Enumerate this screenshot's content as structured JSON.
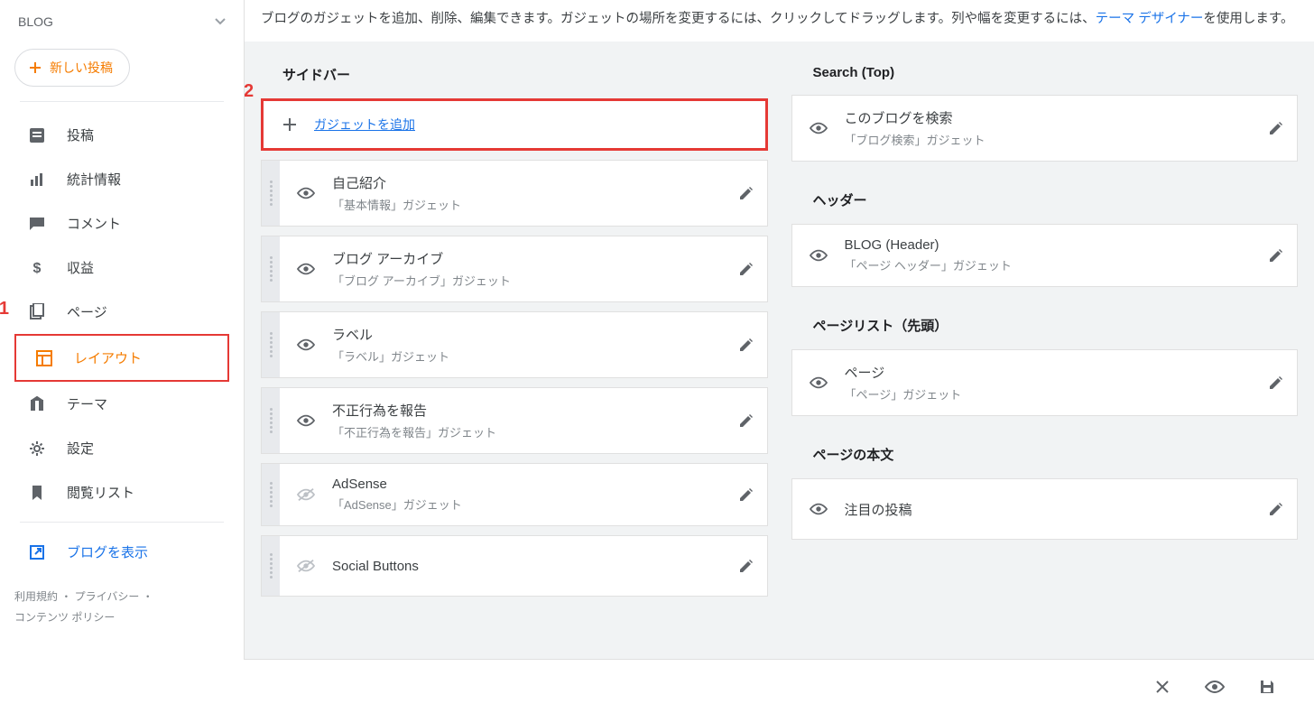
{
  "blogName": "BLOG",
  "newPostLabel": "新しい投稿",
  "nav": {
    "posts": "投稿",
    "stats": "統計情報",
    "comments": "コメント",
    "earnings": "収益",
    "pages": "ページ",
    "layout": "レイアウト",
    "theme": "テーマ",
    "settings": "設定",
    "readinglist": "閲覧リスト",
    "viewblog": "ブログを表示"
  },
  "footer": {
    "line1": "利用規約 ・ プライバシー ・",
    "line2": "コンテンツ ポリシー"
  },
  "description": {
    "pre": "ブログのガジェットを追加、削除、編集できます。ガジェットの場所を変更するには、クリックしてドラッグします。列や幅を変更するには、",
    "link": "テーマ デザイナー",
    "post": "を使用します。"
  },
  "badges": {
    "one": "1",
    "two": "2"
  },
  "left": {
    "section": "サイドバー",
    "addGadget": "ガジェットを追加",
    "gadgets": [
      {
        "title": "自己紹介",
        "sub": "「基本情報」ガジェット",
        "visible": true
      },
      {
        "title": "ブログ アーカイブ",
        "sub": "「ブログ アーカイブ」ガジェット",
        "visible": true
      },
      {
        "title": "ラベル",
        "sub": "「ラベル」ガジェット",
        "visible": true
      },
      {
        "title": "不正行為を報告",
        "sub": "「不正行為を報告」ガジェット",
        "visible": true
      },
      {
        "title": "AdSense",
        "sub": "「AdSense」ガジェット",
        "visible": false
      },
      {
        "title": "Social Buttons",
        "sub": "",
        "visible": false
      }
    ]
  },
  "right": {
    "sections": [
      {
        "title": "Search (Top)",
        "gadgets": [
          {
            "title": "このブログを検索",
            "sub": "「ブログ検索」ガジェット"
          }
        ]
      },
      {
        "title": "ヘッダー",
        "gadgets": [
          {
            "title": "BLOG (Header)",
            "sub": "「ページ ヘッダー」ガジェット"
          }
        ]
      },
      {
        "title": "ページリスト（先頭）",
        "gadgets": [
          {
            "title": "ページ",
            "sub": "「ページ」ガジェット"
          }
        ]
      },
      {
        "title": "ページの本文",
        "gadgets": [
          {
            "title": "注目の投稿",
            "sub": ""
          }
        ]
      }
    ]
  }
}
